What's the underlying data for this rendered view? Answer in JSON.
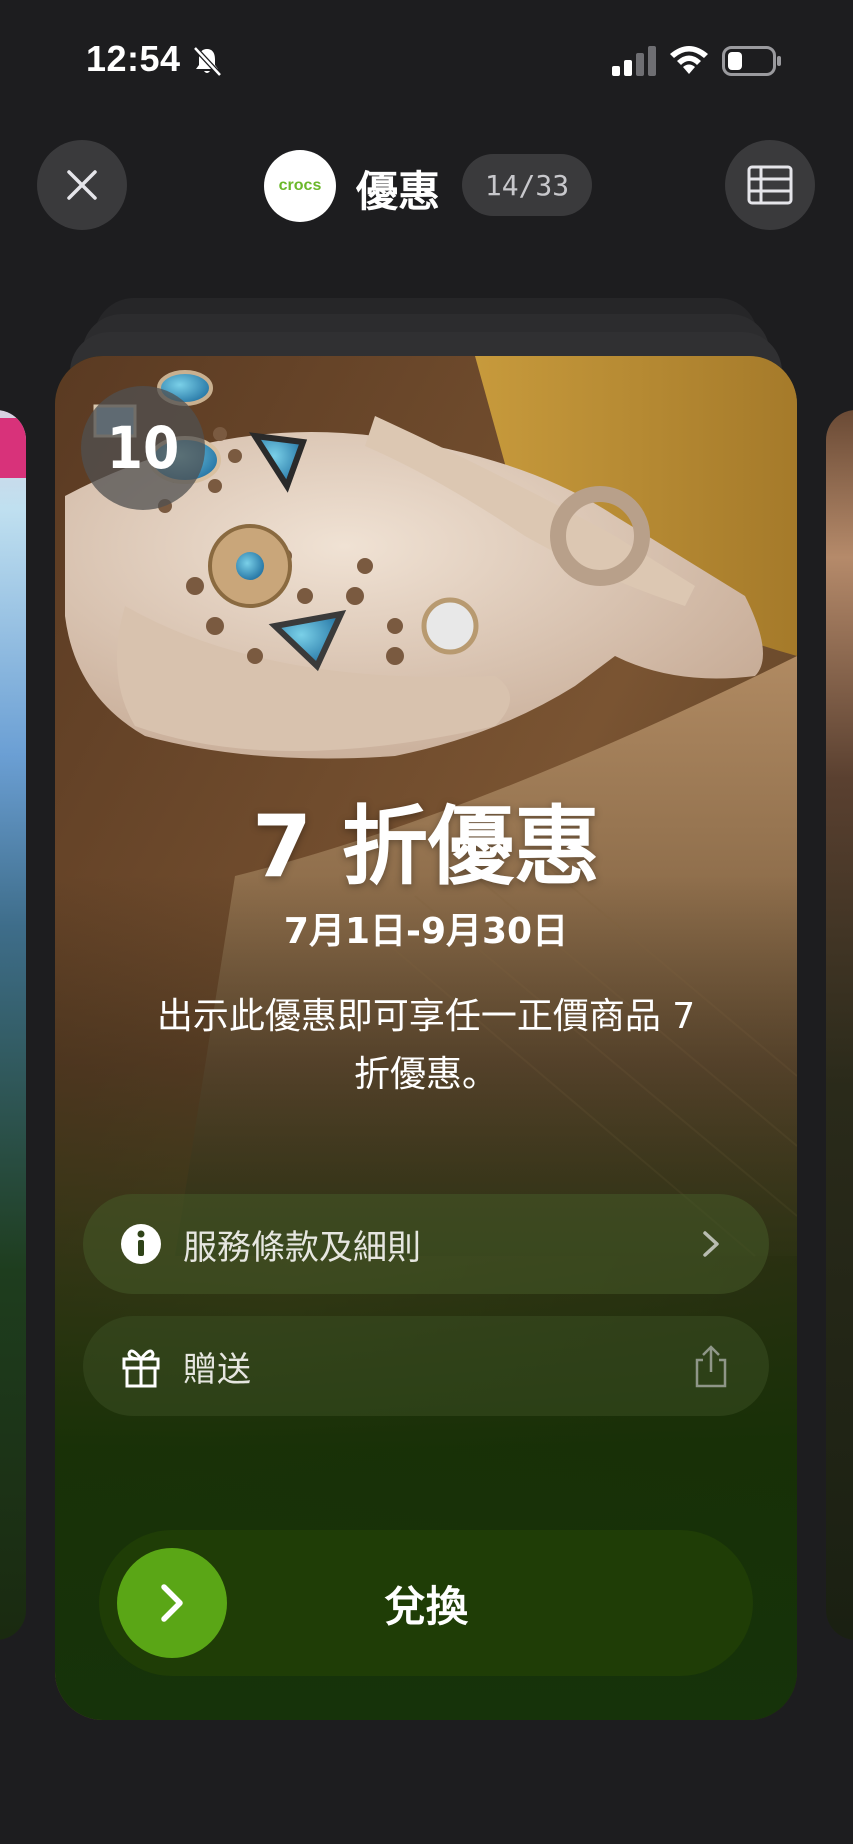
{
  "status_bar": {
    "time": "12:54"
  },
  "header": {
    "brand_logo_text": "crocs",
    "title": "優惠",
    "counter": "14/33"
  },
  "offer": {
    "badge_number": "10",
    "title": "7 折優惠",
    "dates": "7月1日-9月30日",
    "description": "出示此優惠即可享任一正價商品 7 折優惠。",
    "terms_label": "服務條款及細則",
    "gift_label": "贈送",
    "redeem_label": "兌換"
  },
  "colors": {
    "accent_green": "#5aa616",
    "brand_green": "#6bb82a",
    "card_bottom": "#16330a"
  }
}
